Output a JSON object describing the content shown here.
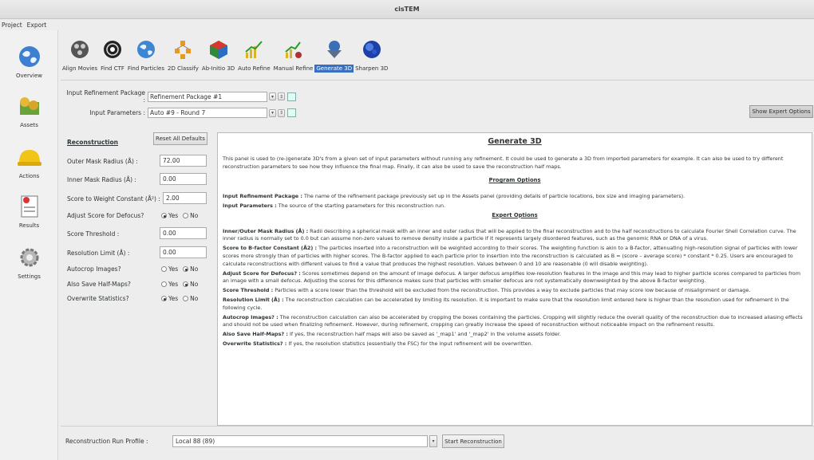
{
  "window": {
    "title": "cisTEM"
  },
  "menu": {
    "project": "Project",
    "export": "Export"
  },
  "sidebar": [
    {
      "label": "Overview",
      "icon": "globe-icon"
    },
    {
      "label": "Assets",
      "icon": "coins-icon"
    },
    {
      "label": "Actions",
      "icon": "hardhat-icon"
    },
    {
      "label": "Results",
      "icon": "results-icon"
    },
    {
      "label": "Settings",
      "icon": "gears-icon"
    }
  ],
  "toolbar": [
    {
      "label": "Align Movies",
      "icon": "film-icon"
    },
    {
      "label": "Find CTF",
      "icon": "ctf-icon"
    },
    {
      "label": "Find Particles",
      "icon": "globe-icon"
    },
    {
      "label": "2D Classify",
      "icon": "hierarchy-icon"
    },
    {
      "label": "Ab-Initio 3D",
      "icon": "cube-icon"
    },
    {
      "label": "Auto Refine",
      "icon": "chart-icon"
    },
    {
      "label": "Manual Refine",
      "icon": "chart-manual-icon"
    },
    {
      "label": "Generate 3D",
      "icon": "generate-icon"
    },
    {
      "label": "Sharpen 3D",
      "icon": "sphere-icon"
    }
  ],
  "inputs": {
    "refinement_package_label": "Input Refinement Package :",
    "refinement_package_value": "Refinement Package #1",
    "parameters_label": "Input Parameters :",
    "parameters_value": "Auto #9 - Round 7",
    "expert_button": "Show Expert Options"
  },
  "reconstruction": {
    "heading": "Reconstruction",
    "reset_button": "Reset All Defaults",
    "outer_mask_label": "Outer Mask Radius (Å) :",
    "outer_mask_value": "72.00",
    "inner_mask_label": "Inner Mask Radius (Å) :",
    "inner_mask_value": "0.00",
    "score_weight_label": "Score to Weight Constant (Å²) :",
    "score_weight_value": "2.00",
    "adjust_defocus_label": "Adjust Score for Defocus?",
    "score_threshold_label": "Score Threshold :",
    "score_threshold_value": "0.00",
    "resolution_limit_label": "Resolution Limit (Å) :",
    "resolution_limit_value": "0.00",
    "autocrop_label": "Autocrop Images?",
    "half_maps_label": "Also Save Half-Maps?",
    "overwrite_label": "Overwrite Statistics?",
    "yes": "Yes",
    "no": "No"
  },
  "help": {
    "title": "Generate 3D",
    "intro": "This panel is used to (re-)generate 3D's from a given set of input parameters without running any refinement.  It could be used to generate a 3D from imported parameters for example.  It can also be used to try different reconstruction parameters to see how they influence the final map.  Finally, it can also be used to save the reconstruction half maps.",
    "program_options": "Program Options",
    "p1_key": "Input Refinement Package :",
    "p1_text": " The name of the refinement package previously set up in the Assets panel (providing details of particle locations, box size and imaging parameters).",
    "p2_key": "Input Parameters :",
    "p2_text": " The source of the starting parameters for this reconstruction run.",
    "expert_options": "Expert Options",
    "e1_key": "Inner/Outer Mask Radius (Å) :",
    "e1_text": " Radii describing a spherical mask with an inner and outer radius that will be applied to the final reconstruction and to the half reconstructions to calculate Fourier Shell Correlation curve. The inner radius is normally set to 0.0 but can assume non-zero values to remove density inside a particle if it represents largely disordered features, such as the genomic RNA or DNA of a virus.",
    "e2_key": "Score to B-factor Constant (Å2) :",
    "e2_text": " The particles inserted into a reconstruction will be weighted according to their scores. The weighting function is akin to a B-factor, attenuating high-resolution signal of particles with lower scores more strongly than of particles with higher scores. The B-factor applied to each particle prior to insertion into the reconstruction is calculated as B = (score – average score) * constant * 0.25. Users are encouraged to calculate reconstructions with different values to find a value that produces the highest resolution. Values between 0 and 10 are reasonable (0 will disable weighting).",
    "e3_key": "Adjust Score for Defocus? :",
    "e3_text": " Scores sometimes depend on the amount of image defocus. A larger defocus amplifies low-resolution features in the image and this may lead to higher particle scores compared to particles from an image with a small defocus. Adjusting the scores for this difference makes sure that particles with smaller defocus are not systematically downweighted by the above B-factor weighting.",
    "e4_key": "Score Threshold :",
    "e4_text": " Particles with a score lower than the threshold will be excluded from the reconstruction. This provides a way to exclude particles that may score low because of misalignment or damage.",
    "e5_key": "Resolution Limit (Å) :",
    "e5_text": " The reconstruction calculation can be accelerated by limiting its resolution. It is important to make sure that the resolution limit entered here is higher than the resolution used for refinement in the following cycle.",
    "e6_key": "Autocrop Images? :",
    "e6_text": " The reconstruction calculation can also be accelerated by cropping the boxes containing the particles. Cropping will slightly reduce the overall quality of the reconstruction due to increased aliasing effects and should not be used when finalizing refinement. However, during refinement, cropping can greatly increase the speed of reconstruction without noticeable impact on the refinement results.",
    "e7_key": "Also Save Half-Maps? :",
    "e7_text": " If yes, the reconstruction half maps will also be saved as '_map1' and '_map2' in the volume assets folder.",
    "e8_key": "Overwrite Statistics? :",
    "e8_text": " If yes, the resolution statistics (essentially the FSC) for the input refinement will be overwritten."
  },
  "bottom": {
    "run_profile_label": "Reconstruction Run Profile :",
    "run_profile_value": "Local 88 (89)",
    "start_button": "Start Reconstruction"
  }
}
